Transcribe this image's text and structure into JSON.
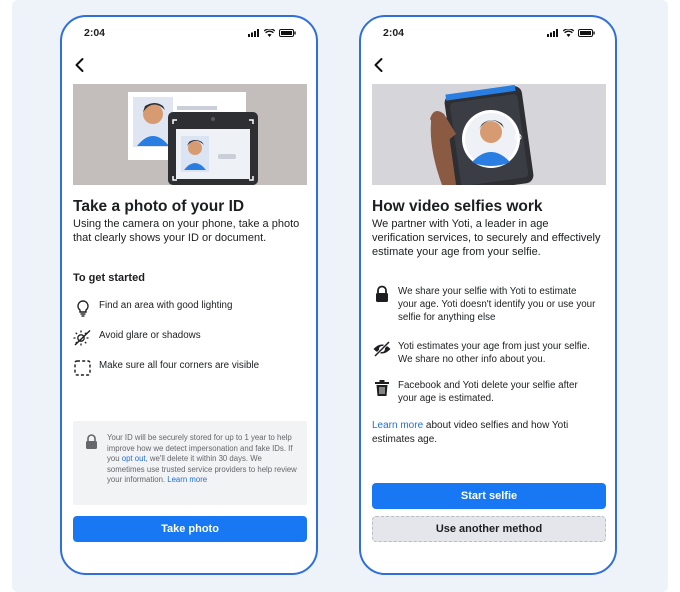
{
  "left_phone": {
    "status_time": "2:04",
    "title": "Take a photo of your ID",
    "description": "Using the camera on your phone, take a photo that clearly shows your ID or document.",
    "section_heading": "To get started",
    "tips": [
      {
        "icon": "lightbulb-icon",
        "label": "Find an area with good lighting"
      },
      {
        "icon": "no-glare-icon",
        "label": "Avoid glare or shadows"
      },
      {
        "icon": "corners-frame-icon",
        "label": "Make sure all four corners are visible"
      }
    ],
    "privacy": {
      "text_before": "Your ID will be securely stored for up to 1 year to help improve how we detect impersonation and fake IDs. If you ",
      "opt_out_link": "opt out",
      "text_after": ", we'll delete it within 30 days. We sometimes use trusted service providers to help review your information. ",
      "learn_more_link": "Learn more"
    },
    "button_label": "Take photo"
  },
  "right_phone": {
    "status_time": "2:04",
    "title": "How video selfies work",
    "description": "We partner with Yoti, a leader in age verification services, to securely and effectively estimate your age from your selfie.",
    "points": [
      {
        "icon": "lock-icon",
        "label": "We share your selfie with Yoti to estimate your age. Yoti doesn't identify you or use your selfie for anything else"
      },
      {
        "icon": "eye-slash-icon",
        "label": "Yoti estimates your age from just your selfie. We share no other info about you."
      },
      {
        "icon": "trash-icon",
        "label": "Facebook and Yoti delete your selfie after your age is estimated."
      }
    ],
    "learn_more_link": "Learn more",
    "learn_more_text": " about video selfies and how Yoti estimates age.",
    "primary_button": "Start selfie",
    "secondary_button": "Use another method"
  },
  "colors": {
    "accent": "#1877f2",
    "frame": "#2f6fdc",
    "background": "#eef2f9",
    "link": "#216fdb"
  }
}
